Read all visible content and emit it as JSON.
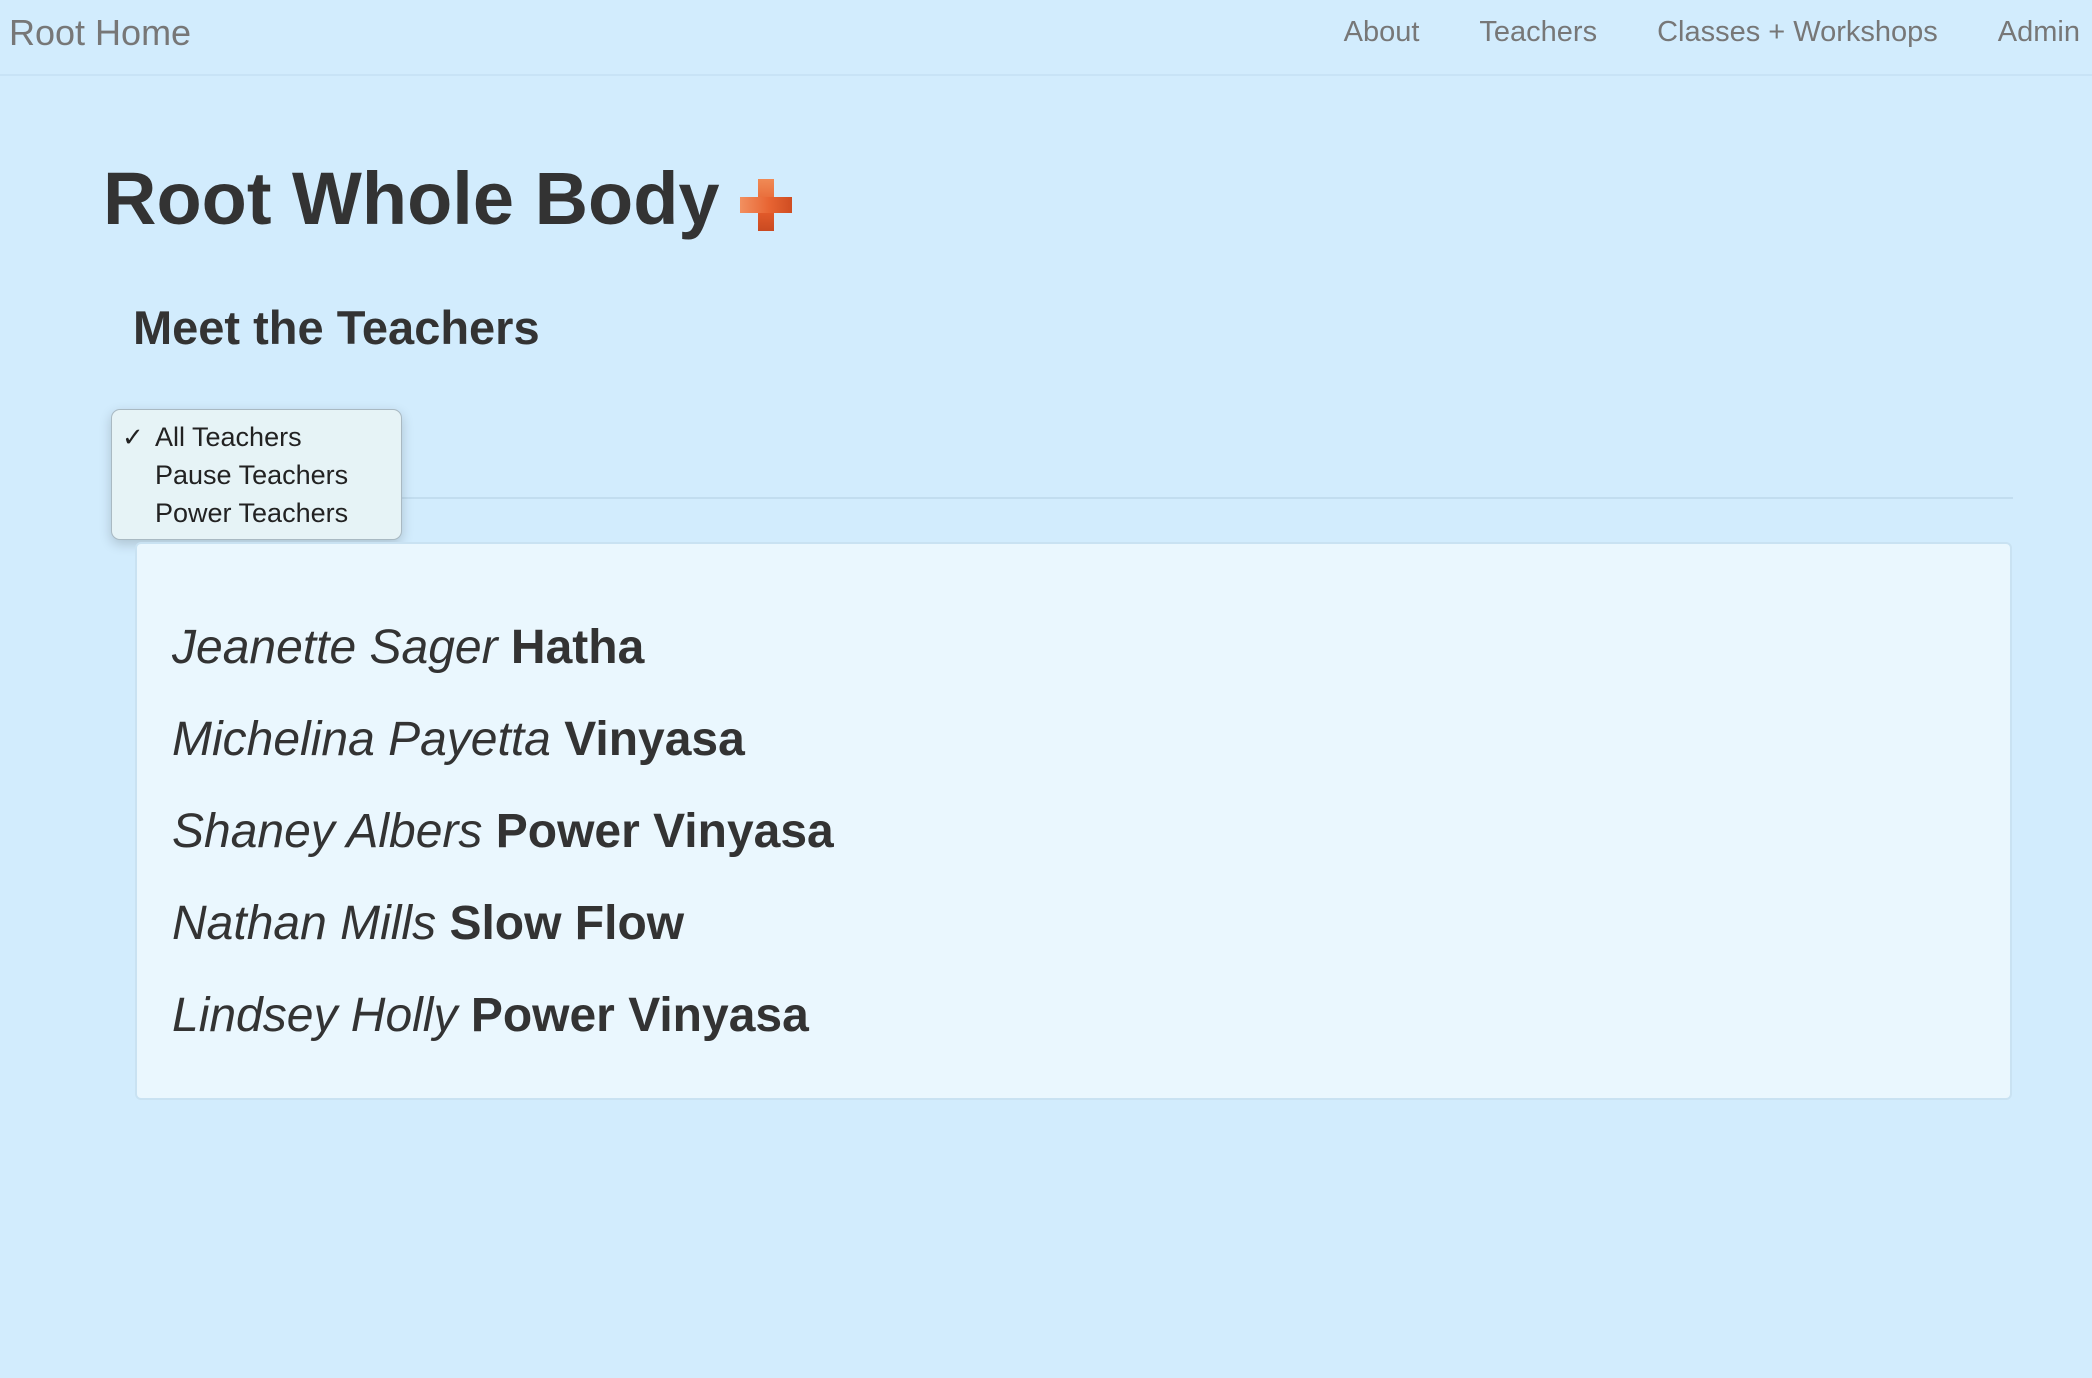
{
  "navbar": {
    "brand": "Root Home",
    "links": [
      "About",
      "Teachers",
      "Classes + Workshops",
      "Admin"
    ]
  },
  "page": {
    "title": "Root Whole Body",
    "title_icon": "orange-plus-icon",
    "section_title": "Meet the Teachers"
  },
  "filter": {
    "options": [
      "All Teachers",
      "Pause Teachers",
      "Power Teachers"
    ],
    "selected": "All Teachers",
    "check_mark": "✓"
  },
  "teachers": [
    {
      "name": "Jeanette Sager",
      "style": "Hatha"
    },
    {
      "name": "Michelina Payetta",
      "style": "Vinyasa"
    },
    {
      "name": "Shaney Albers",
      "style": "Power Vinyasa"
    },
    {
      "name": "Nathan Mills",
      "style": "Slow Flow"
    },
    {
      "name": "Lindsey Holly",
      "style": "Power Vinyasa"
    }
  ],
  "colors": {
    "background": "#d2ecfd",
    "panel": "#eaf7fe",
    "accent": "#e55c2b",
    "nav_text": "#777777",
    "text": "#333333"
  }
}
